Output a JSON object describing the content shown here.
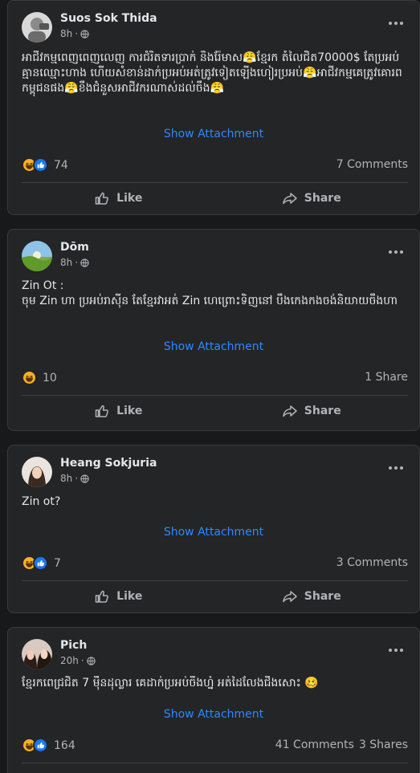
{
  "posts": [
    {
      "author": "Suos Sok Thida",
      "time": "8h",
      "separator": "·",
      "text": "អាជីវកម្មពេញពេញលេញ ការជំរិតទារប្រាក់ និងរ៉ែមាស😤ខ្មែរក តំលៃជិត70000$ តែប្រអប់គ្មានឈ្មោះហាង ហើយសំខាន់ដាក់ប្រអប់អត់ត្រូវទៀតឡើងហៀរប្រអប់😤អាជីវកម្មគេត្រូវគោរពកម្ពុជនផង😤ខឹងជំនួសអាជីវករណាស់ដល់ចឹង😤",
      "attachment": "Show Attachment",
      "reaction_count": "74",
      "comments": "7 Comments",
      "shares": "",
      "reactions": [
        "haha",
        "like"
      ]
    },
    {
      "author": "Dōm",
      "time": "8h",
      "separator": "·",
      "text": "Zin Ot :\nចុម Zin ហា ប្រអប់រាស៊ីន តែខ្មែរវាអត់ Zin ហេព្រោះទិញនៅ បឹងកេងកងចង់និយាយចឹងហា",
      "attachment": "Show Attachment",
      "reaction_count": "10",
      "comments": "",
      "shares": "1 Share",
      "reactions": [
        "haha"
      ]
    },
    {
      "author": "Heang Sokjuria",
      "time": "8h",
      "separator": "·",
      "text": "Zin ot?",
      "attachment": "Show Attachment",
      "reaction_count": "7",
      "comments": "3 Comments",
      "shares": "",
      "reactions": [
        "haha",
        "like"
      ]
    },
    {
      "author": "Pich",
      "time": "20h",
      "separator": "·",
      "text": "ខ្មែរកពេជ្រជិត 7 ម៉ឺនដុល្លារ គេដាក់ប្រអប់ចឹងហ្ន៎ អត់ដៃលែងជឹងសោះ 🥴",
      "attachment": "Show Attachment",
      "reaction_count": "164",
      "comments": "41 Comments",
      "shares": "3 Shares",
      "reactions": [
        "haha",
        "like"
      ]
    }
  ],
  "actions": {
    "like_label": "Like",
    "share_label": "Share"
  },
  "icons": {
    "more": "more-horizontal-icon",
    "privacy": "globe-icon",
    "like": "thumbs-up-icon",
    "share": "share-arrow-icon",
    "haha": "haha-reaction-icon",
    "like_reaction": "like-reaction-icon"
  },
  "colors": {
    "link": "#2d88ff",
    "haha": "#f7b125",
    "like": "#1877f2",
    "card": "#242526"
  }
}
